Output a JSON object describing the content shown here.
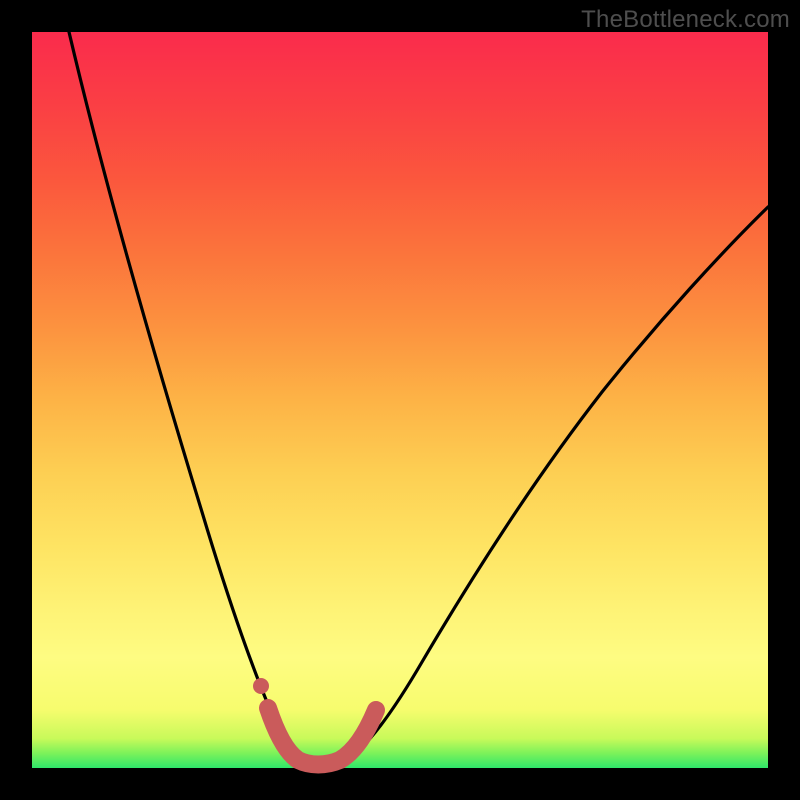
{
  "watermark": "TheBottleneck.com",
  "chart_data": {
    "type": "line",
    "title": "",
    "xlabel": "",
    "ylabel": "",
    "xlim": [
      0,
      1
    ],
    "ylim": [
      0,
      1
    ],
    "x": [
      0.05,
      0.08,
      0.11,
      0.14,
      0.17,
      0.2,
      0.23,
      0.26,
      0.28,
      0.3,
      0.32,
      0.34,
      0.36,
      0.38,
      0.4,
      0.44,
      0.48,
      0.52,
      0.56,
      0.6,
      0.65,
      0.7,
      0.75,
      0.8,
      0.85,
      0.9,
      0.95,
      1.0
    ],
    "y": [
      1.0,
      0.88,
      0.76,
      0.65,
      0.55,
      0.45,
      0.36,
      0.27,
      0.2,
      0.14,
      0.09,
      0.05,
      0.02,
      0.005,
      0.005,
      0.02,
      0.06,
      0.12,
      0.18,
      0.24,
      0.31,
      0.38,
      0.44,
      0.5,
      0.55,
      0.6,
      0.64,
      0.67
    ],
    "min_region_x": [
      0.34,
      0.44
    ],
    "highlight_points_x": [
      0.32,
      0.33,
      0.34,
      0.355,
      0.37,
      0.385,
      0.4,
      0.415,
      0.43,
      0.44,
      0.45
    ],
    "highlight_points_y": [
      0.09,
      0.055,
      0.03,
      0.012,
      0.005,
      0.004,
      0.005,
      0.012,
      0.025,
      0.045,
      0.07
    ],
    "colors": {
      "curve": "#000000",
      "highlight": "#ca5b5b",
      "background_top": "#fa2b4c",
      "background_bottom": "#2fe66a"
    }
  }
}
